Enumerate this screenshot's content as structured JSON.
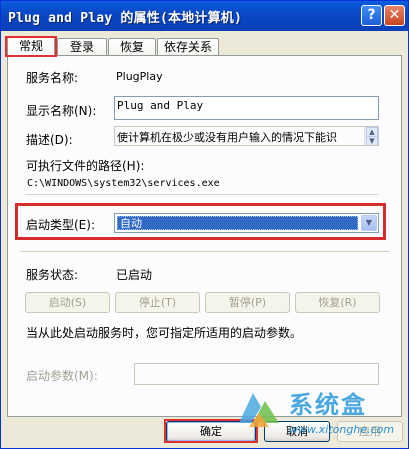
{
  "window": {
    "title": "Plug and Play 的属性(本地计算机)",
    "help_glyph": "?",
    "close_glyph": "✕"
  },
  "tabs": [
    {
      "label": "常规"
    },
    {
      "label": "登录"
    },
    {
      "label": "恢复"
    },
    {
      "label": "依存关系"
    }
  ],
  "general": {
    "service_name_label": "服务名称:",
    "service_name_value": "PlugPlay",
    "display_name_label": "显示名称(N):",
    "display_name_value": "Plug and Play",
    "description_label": "描述(D):",
    "description_value": "使计算机在极少或没有用户输入的情况下能识",
    "exe_path_label": "可执行文件的路径(H):",
    "exe_path_value": "C:\\WINDOWS\\system32\\services.exe",
    "startup_type_label": "启动类型(E):",
    "startup_type_value": "自动",
    "service_status_label": "服务状态:",
    "service_status_value": "已启动",
    "buttons": {
      "start": "启动(S)",
      "stop": "停止(T)",
      "pause": "暂停(P)",
      "resume": "恢复(R)"
    },
    "hint_text": "当从此处启动服务时，您可指定所适用的启动参数。",
    "start_params_label": "启动参数(M):",
    "start_params_value": ""
  },
  "footer": {
    "ok": "确定",
    "cancel": "取消",
    "apply": "应用"
  },
  "watermark": {
    "brand_cn": "系统盒",
    "url": "www.xitonghe.com"
  },
  "colors": {
    "titlebar": "#0a5ddc",
    "highlight_red": "#d52d2d",
    "selection_blue": "#316ac5",
    "dialog_bg": "#ece9d8"
  }
}
